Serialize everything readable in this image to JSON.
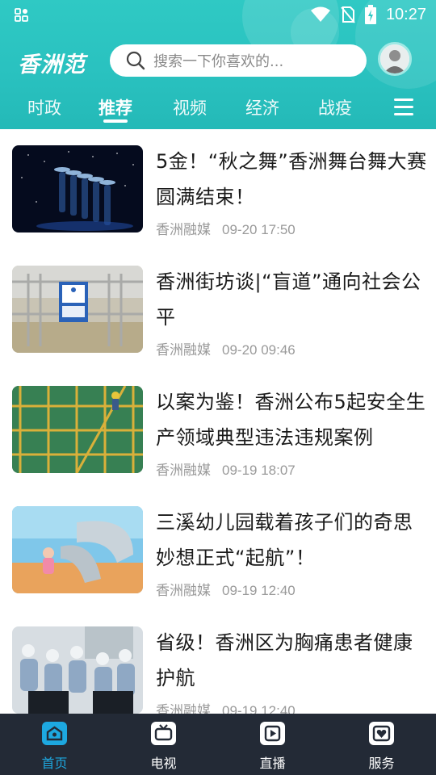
{
  "status_bar": {
    "time": "10:27"
  },
  "header": {
    "logo_text": "香洲范",
    "search": {
      "placeholder": "搜索一下你喜欢的..."
    },
    "accent_color": "#2fc9c4"
  },
  "tabs": [
    {
      "label": "时政",
      "active": false
    },
    {
      "label": "推荐",
      "active": true
    },
    {
      "label": "视频",
      "active": false
    },
    {
      "label": "经济",
      "active": false
    },
    {
      "label": "战疫",
      "active": false
    }
  ],
  "news": [
    {
      "title": "5金！“秋之舞”香洲舞台舞大赛圆满结束！",
      "source": "香洲融媒",
      "date": "09-20 17:50"
    },
    {
      "title": "香洲街坊谈|“盲道”通向社会公平",
      "source": "香洲融媒",
      "date": "09-20 09:46"
    },
    {
      "title": "以案为鉴！香洲公布5起安全生产领域典型违法违规案例",
      "source": "香洲融媒",
      "date": "09-19 18:07"
    },
    {
      "title": "三溪幼儿园载着孩子们的奇思妙想正式“起航”！",
      "source": "香洲融媒",
      "date": "09-19 12:40"
    },
    {
      "title": "省级！香洲区为胸痛患者健康护航",
      "source": "香洲融媒",
      "date": "09-19 12:40"
    }
  ],
  "bottom_nav": [
    {
      "label": "首页",
      "icon": "home-icon",
      "active": true
    },
    {
      "label": "电视",
      "icon": "tv-icon",
      "active": false
    },
    {
      "label": "直播",
      "icon": "live-play-icon",
      "active": false
    },
    {
      "label": "服务",
      "icon": "heart-service-icon",
      "active": false
    }
  ],
  "colors": {
    "active_nav": "#1da8e0",
    "nav_background": "#232a36",
    "meta_text": "#9a9a9a"
  }
}
